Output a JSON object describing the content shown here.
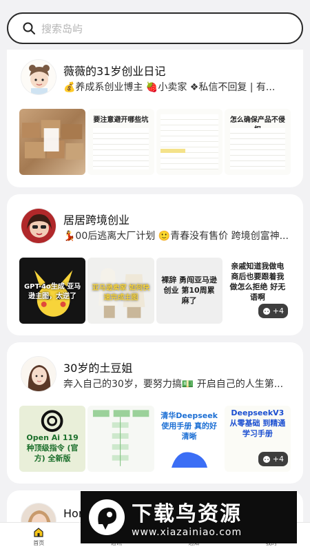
{
  "search": {
    "placeholder": "搜索岛屿"
  },
  "feed": [
    {
      "name": "薇薇的31岁创业日记",
      "bio": "💰养成系创业博主 🍓小卖家 ❖私信不回复 | 有...",
      "thumbs": [
        "",
        "要注意避开哪些坑",
        "",
        "怎么确保产品不侵权"
      ]
    },
    {
      "name": "居居跨境创业",
      "bio": "💃00后逃离大厂计划 🙂青春没有售价 跨境创富神...",
      "thumbs": [
        "GPT-4o生成 亚马逊主图，太逆了",
        "亚马逊卖家 如何快速完成主图",
        "裸辞 勇闯亚马逊创业 第10周累麻了",
        "亲戚知道我做电 商后也要跟着我 做怎么拒绝 好无语啊"
      ],
      "more": "+4"
    },
    {
      "name": "30岁的土豆姐",
      "bio": "奔入自己的30岁，要努力搞💵 开启自己的人生第...",
      "thumbs": [
        "Open Ai 119种顶级指令 (官方) 全新版",
        "",
        "清华Deepseek 使用手册 真的好清晰",
        "DeepseekV3 从零基础 到精通 学习手册"
      ],
      "more": "+4"
    },
    {
      "name": "Hor"
    }
  ],
  "tabs": [
    {
      "label": "首页",
      "active": true
    },
    {
      "label": "通讯"
    },
    {
      "label": "通知"
    },
    {
      "label": "我的"
    }
  ],
  "watermark": {
    "title": "下载鸟资源",
    "url": "www.xiazainiao.com"
  },
  "colors": {
    "accent": "#f5c518",
    "text": "#1a1a1a",
    "bg": "#f2f2f4"
  }
}
